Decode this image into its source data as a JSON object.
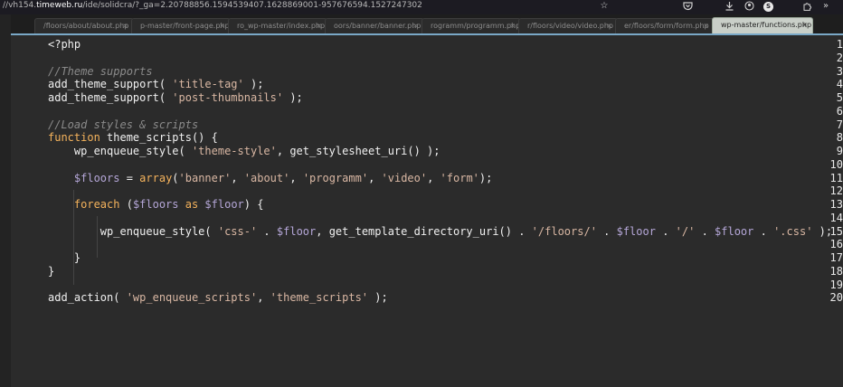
{
  "browser": {
    "url_prefix": "//vh154.",
    "url_domain": "timeweb.ru",
    "url_rest": "/ide/solidcra/?_ga=2.20788856.1594539407.1628869001-957676594.1527247302",
    "icons": [
      "star-icon",
      "pocket-icon",
      "download-icon",
      "profile-icon",
      "extensions-icon",
      "overflow-icon"
    ],
    "badge": "S"
  },
  "tabs": [
    {
      "label": "/floors/about/about.php",
      "close": "×"
    },
    {
      "label": "p-master/front-page.php",
      "close": "×"
    },
    {
      "label": "ro_wp-master/index.php",
      "close": "×"
    },
    {
      "label": "oors/banner/banner.php",
      "close": "×"
    },
    {
      "label": "rogramm/programm.php",
      "close": "×"
    },
    {
      "label": "r/floors/video/video.php",
      "close": "×"
    },
    {
      "label": "er/floors/form/form.php",
      "close": "×"
    },
    {
      "label": "wp-master/functions.php",
      "close": "×"
    }
  ],
  "active_tab": 7,
  "editor": {
    "line_numbers": [
      "1",
      "2",
      "3",
      "4",
      "5",
      "6",
      "7",
      "8",
      "9",
      "10",
      "11",
      "12",
      "13",
      "14",
      "15",
      "16",
      "17",
      "18",
      "19",
      "20"
    ],
    "lines": [
      {
        "t": "<?php"
      },
      {
        "t": ""
      },
      {
        "c": "//Theme supports"
      },
      {
        "f": "add_theme_support( ",
        "s": "'title-tag'",
        "e": " );"
      },
      {
        "f": "add_theme_support( ",
        "s": "'post-thumbnails'",
        "e": " );"
      },
      {
        "t": ""
      },
      {
        "c": "//Load styles & scripts"
      },
      {
        "k": "function",
        "e": " theme_scripts() {"
      },
      {
        "i": "    ",
        "f": "wp_enqueue_style( ",
        "s": "'theme-style'",
        "e": ", get_stylesheet_uri() );"
      },
      {
        "t": ""
      },
      {
        "i": "    ",
        "v": "$floors",
        "e": " = ",
        "k2": "array",
        "e2": "(",
        "s": "'banner'",
        "e3": ", ",
        "s2": "'about'",
        "e4": ", ",
        "s3": "'programm'",
        "e5": ", ",
        "s4": "'video'",
        "e6": ", ",
        "s5": "'form'",
        "e7": ");"
      },
      {
        "t": ""
      },
      {
        "i": "    ",
        "k": "foreach",
        "e": " (",
        "v": "$floors",
        "k2": " as ",
        "v2": "$floor",
        "e2": ") {"
      },
      {
        "t": ""
      },
      {
        "i": "        ",
        "f": "wp_enqueue_style( ",
        "s": "'css-'",
        "e": " . ",
        "v": "$floor",
        "e2": ", get_template_directory_uri() . ",
        "s2": "'/floors/'",
        "e3": " . ",
        "v2": "$floor",
        "e4": " . ",
        "s3": "'/'",
        "e5": " . ",
        "v3": "$floor",
        "e6": " . ",
        "s4": "'.css'",
        "e7": " );"
      },
      {
        "t": ""
      },
      {
        "i": "    ",
        "t": "}"
      },
      {
        "t": "}"
      },
      {
        "t": ""
      },
      {
        "f": "add_action( ",
        "s": "'wp_enqueue_scripts'",
        "e": ", ",
        "s2": "'theme_scripts'",
        "e2": " );"
      }
    ]
  }
}
